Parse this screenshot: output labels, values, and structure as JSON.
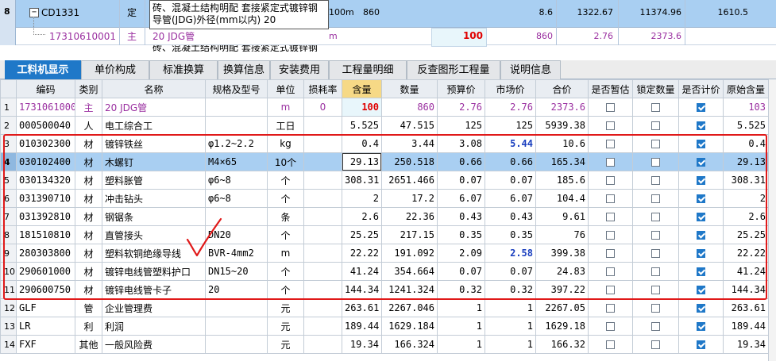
{
  "top_rows": {
    "row1": {
      "num": "8",
      "expander": "−",
      "code": "CD1331",
      "type": "定",
      "name_line1": "砖、混凝土结构明配 套接紧定式镀锌钢",
      "name_line2": "导管(JDG)外径(mm以内) 20",
      "unit": "100m",
      "qty": "860",
      "price1": "8.6",
      "price2": "1322.67",
      "price3": "11374.96",
      "price4": "1610.5"
    },
    "row2": {
      "code": "17310610001",
      "type": "主",
      "name": "20 JDG管",
      "unit": "m",
      "content": "100",
      "qty": "860",
      "price": "2.76",
      "total": "2373.6"
    },
    "row3": {
      "name": "砖、混凝土结构明配 套接紧定式镀锌钢"
    }
  },
  "tabs": [
    {
      "label": "工料机显示",
      "active": true
    },
    {
      "label": "单价构成",
      "active": false
    },
    {
      "label": "标准换算",
      "active": false
    },
    {
      "label": "换算信息",
      "active": false
    },
    {
      "label": "安装费用",
      "active": false
    },
    {
      "label": "工程量明细",
      "active": false
    },
    {
      "label": "反查图形工程量",
      "active": false
    },
    {
      "label": "说明信息",
      "active": false
    }
  ],
  "grid": {
    "headers": [
      "",
      "编码",
      "类别",
      "名称",
      "规格及型号",
      "单位",
      "损耗率",
      "含量",
      "数量",
      "预算价",
      "市场价",
      "合价",
      "是否暂估",
      "锁定数量",
      "是否计价",
      "原始含量"
    ],
    "rows": [
      {
        "n": "1",
        "code": "17310610001",
        "type": "主",
        "name": "20 JDG管",
        "spec": "",
        "unit": "m",
        "loss": "0",
        "content": "100",
        "qty": "860",
        "budget": "2.76",
        "market": "2.76",
        "total": "2373.6",
        "est": false,
        "lock": false,
        "priced": true,
        "orig": "103",
        "style": "purple"
      },
      {
        "n": "2",
        "code": "000500040",
        "type": "人",
        "name": "电工综合工",
        "spec": "",
        "unit": "工日",
        "loss": "",
        "content": "5.525",
        "qty": "47.515",
        "budget": "125",
        "market": "125",
        "total": "5939.38",
        "est": false,
        "lock": false,
        "priced": true,
        "orig": "5.525",
        "style": ""
      },
      {
        "n": "3",
        "code": "010302300",
        "type": "材",
        "name": "镀锌铁丝",
        "spec": "φ1.2~2.2",
        "unit": "kg",
        "loss": "",
        "content": "0.4",
        "qty": "3.44",
        "budget": "3.08",
        "market": "5.44",
        "total": "10.6",
        "est": false,
        "lock": false,
        "priced": true,
        "orig": "0.4",
        "style": "",
        "market_style": "blue"
      },
      {
        "n": "4",
        "code": "030102400",
        "type": "材",
        "name": "木螺钉",
        "spec": "M4×65",
        "unit": "10个",
        "loss": "",
        "content": "29.13",
        "qty": "250.518",
        "budget": "0.66",
        "market": "0.66",
        "total": "165.34",
        "est": false,
        "lock": false,
        "priced": true,
        "orig": "29.13",
        "style": "sel"
      },
      {
        "n": "5",
        "code": "030134320",
        "type": "材",
        "name": "塑料胀管",
        "spec": "φ6~8",
        "unit": "个",
        "loss": "",
        "content": "308.31",
        "qty": "2651.466",
        "budget": "0.07",
        "market": "0.07",
        "total": "185.6",
        "est": false,
        "lock": false,
        "priced": true,
        "orig": "308.31",
        "style": ""
      },
      {
        "n": "6",
        "code": "031390710",
        "type": "材",
        "name": "冲击钻头",
        "spec": "φ6~8",
        "unit": "个",
        "loss": "",
        "content": "2",
        "qty": "17.2",
        "budget": "6.07",
        "market": "6.07",
        "total": "104.4",
        "est": false,
        "lock": false,
        "priced": true,
        "orig": "2",
        "style": ""
      },
      {
        "n": "7",
        "code": "031392810",
        "type": "材",
        "name": "钢锯条",
        "spec": "",
        "unit": "条",
        "loss": "",
        "content": "2.6",
        "qty": "22.36",
        "budget": "0.43",
        "market": "0.43",
        "total": "9.61",
        "est": false,
        "lock": false,
        "priced": true,
        "orig": "2.6",
        "style": ""
      },
      {
        "n": "8",
        "code": "181510810",
        "type": "材",
        "name": "直管接头",
        "spec": "DN20",
        "unit": "个",
        "loss": "",
        "content": "25.25",
        "qty": "217.15",
        "budget": "0.35",
        "market": "0.35",
        "total": "76",
        "est": false,
        "lock": false,
        "priced": true,
        "orig": "25.25",
        "style": ""
      },
      {
        "n": "9",
        "code": "280303800",
        "type": "材",
        "name": "塑料软铜绝缘导线",
        "spec": "BVR-4mm2",
        "unit": "m",
        "loss": "",
        "content": "22.22",
        "qty": "191.092",
        "budget": "2.09",
        "market": "2.58",
        "total": "399.38",
        "est": false,
        "lock": false,
        "priced": true,
        "orig": "22.22",
        "style": "",
        "market_style": "blue"
      },
      {
        "n": "10",
        "code": "290601000",
        "type": "材",
        "name": "镀锌电线管塑料护口",
        "spec": "DN15~20",
        "unit": "个",
        "loss": "",
        "content": "41.24",
        "qty": "354.664",
        "budget": "0.07",
        "market": "0.07",
        "total": "24.83",
        "est": false,
        "lock": false,
        "priced": true,
        "orig": "41.24",
        "style": ""
      },
      {
        "n": "11",
        "code": "290600750",
        "type": "材",
        "name": "镀锌电线管卡子",
        "spec": "20",
        "unit": "个",
        "loss": "",
        "content": "144.34",
        "qty": "1241.324",
        "budget": "0.32",
        "market": "0.32",
        "total": "397.22",
        "est": false,
        "lock": false,
        "priced": true,
        "orig": "144.34",
        "style": ""
      },
      {
        "n": "12",
        "code": "GLF",
        "type": "管",
        "name": "企业管理费",
        "spec": "",
        "unit": "元",
        "loss": "",
        "content": "263.61",
        "qty": "2267.046",
        "budget": "1",
        "market": "1",
        "total": "2267.05",
        "est": false,
        "lock": false,
        "priced": true,
        "orig": "263.61",
        "style": ""
      },
      {
        "n": "13",
        "code": "LR",
        "type": "利",
        "name": "利润",
        "spec": "",
        "unit": "元",
        "loss": "",
        "content": "189.44",
        "qty": "1629.184",
        "budget": "1",
        "market": "1",
        "total": "1629.18",
        "est": false,
        "lock": false,
        "priced": true,
        "orig": "189.44",
        "style": ""
      },
      {
        "n": "14",
        "code": "FXF",
        "type": "其他",
        "name": "一般风险费",
        "spec": "",
        "unit": "元",
        "loss": "",
        "content": "19.34",
        "qty": "166.324",
        "budget": "1",
        "market": "1",
        "total": "166.32",
        "est": false,
        "lock": false,
        "priced": true,
        "orig": "19.34",
        "style": ""
      }
    ]
  },
  "colors": {
    "accent": "#1f78c8",
    "selected_row": "#a9cff2",
    "annotation_red": "#e01919",
    "market_blue": "#1a3fbf"
  }
}
